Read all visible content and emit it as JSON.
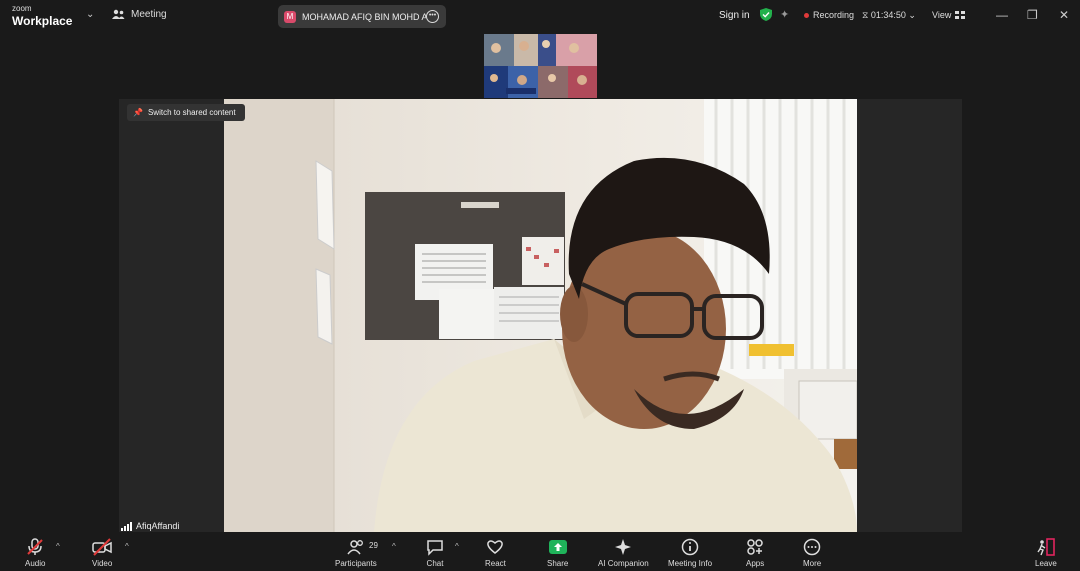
{
  "app": {
    "brand_small": "zoom",
    "brand_big": "Workplace"
  },
  "header": {
    "meeting_menu_label": "Meeting",
    "presenter_initial": "M",
    "presenter_name": "MOHAMAD AFIQ BIN MOHD AF",
    "sign_in_label": "Sign in",
    "recording_label": "Recording",
    "timer": "01:34:50",
    "view_label": "View"
  },
  "stage": {
    "switch_label": "Switch to shared content",
    "participant_name": "AfiqAffandi"
  },
  "toolbar": {
    "audio": "Audio",
    "video": "Video",
    "participants": "Participants",
    "participants_count": "29",
    "chat": "Chat",
    "react": "React",
    "share": "Share",
    "ai_companion": "AI Companion",
    "meeting_info": "Meeting Info",
    "apps": "Apps",
    "more": "More",
    "leave": "Leave"
  },
  "colors": {
    "share_green": "#1fb35a",
    "leave_red": "#e0245e",
    "mute_red": "#e03a3a",
    "shield_green": "#22b14c"
  }
}
